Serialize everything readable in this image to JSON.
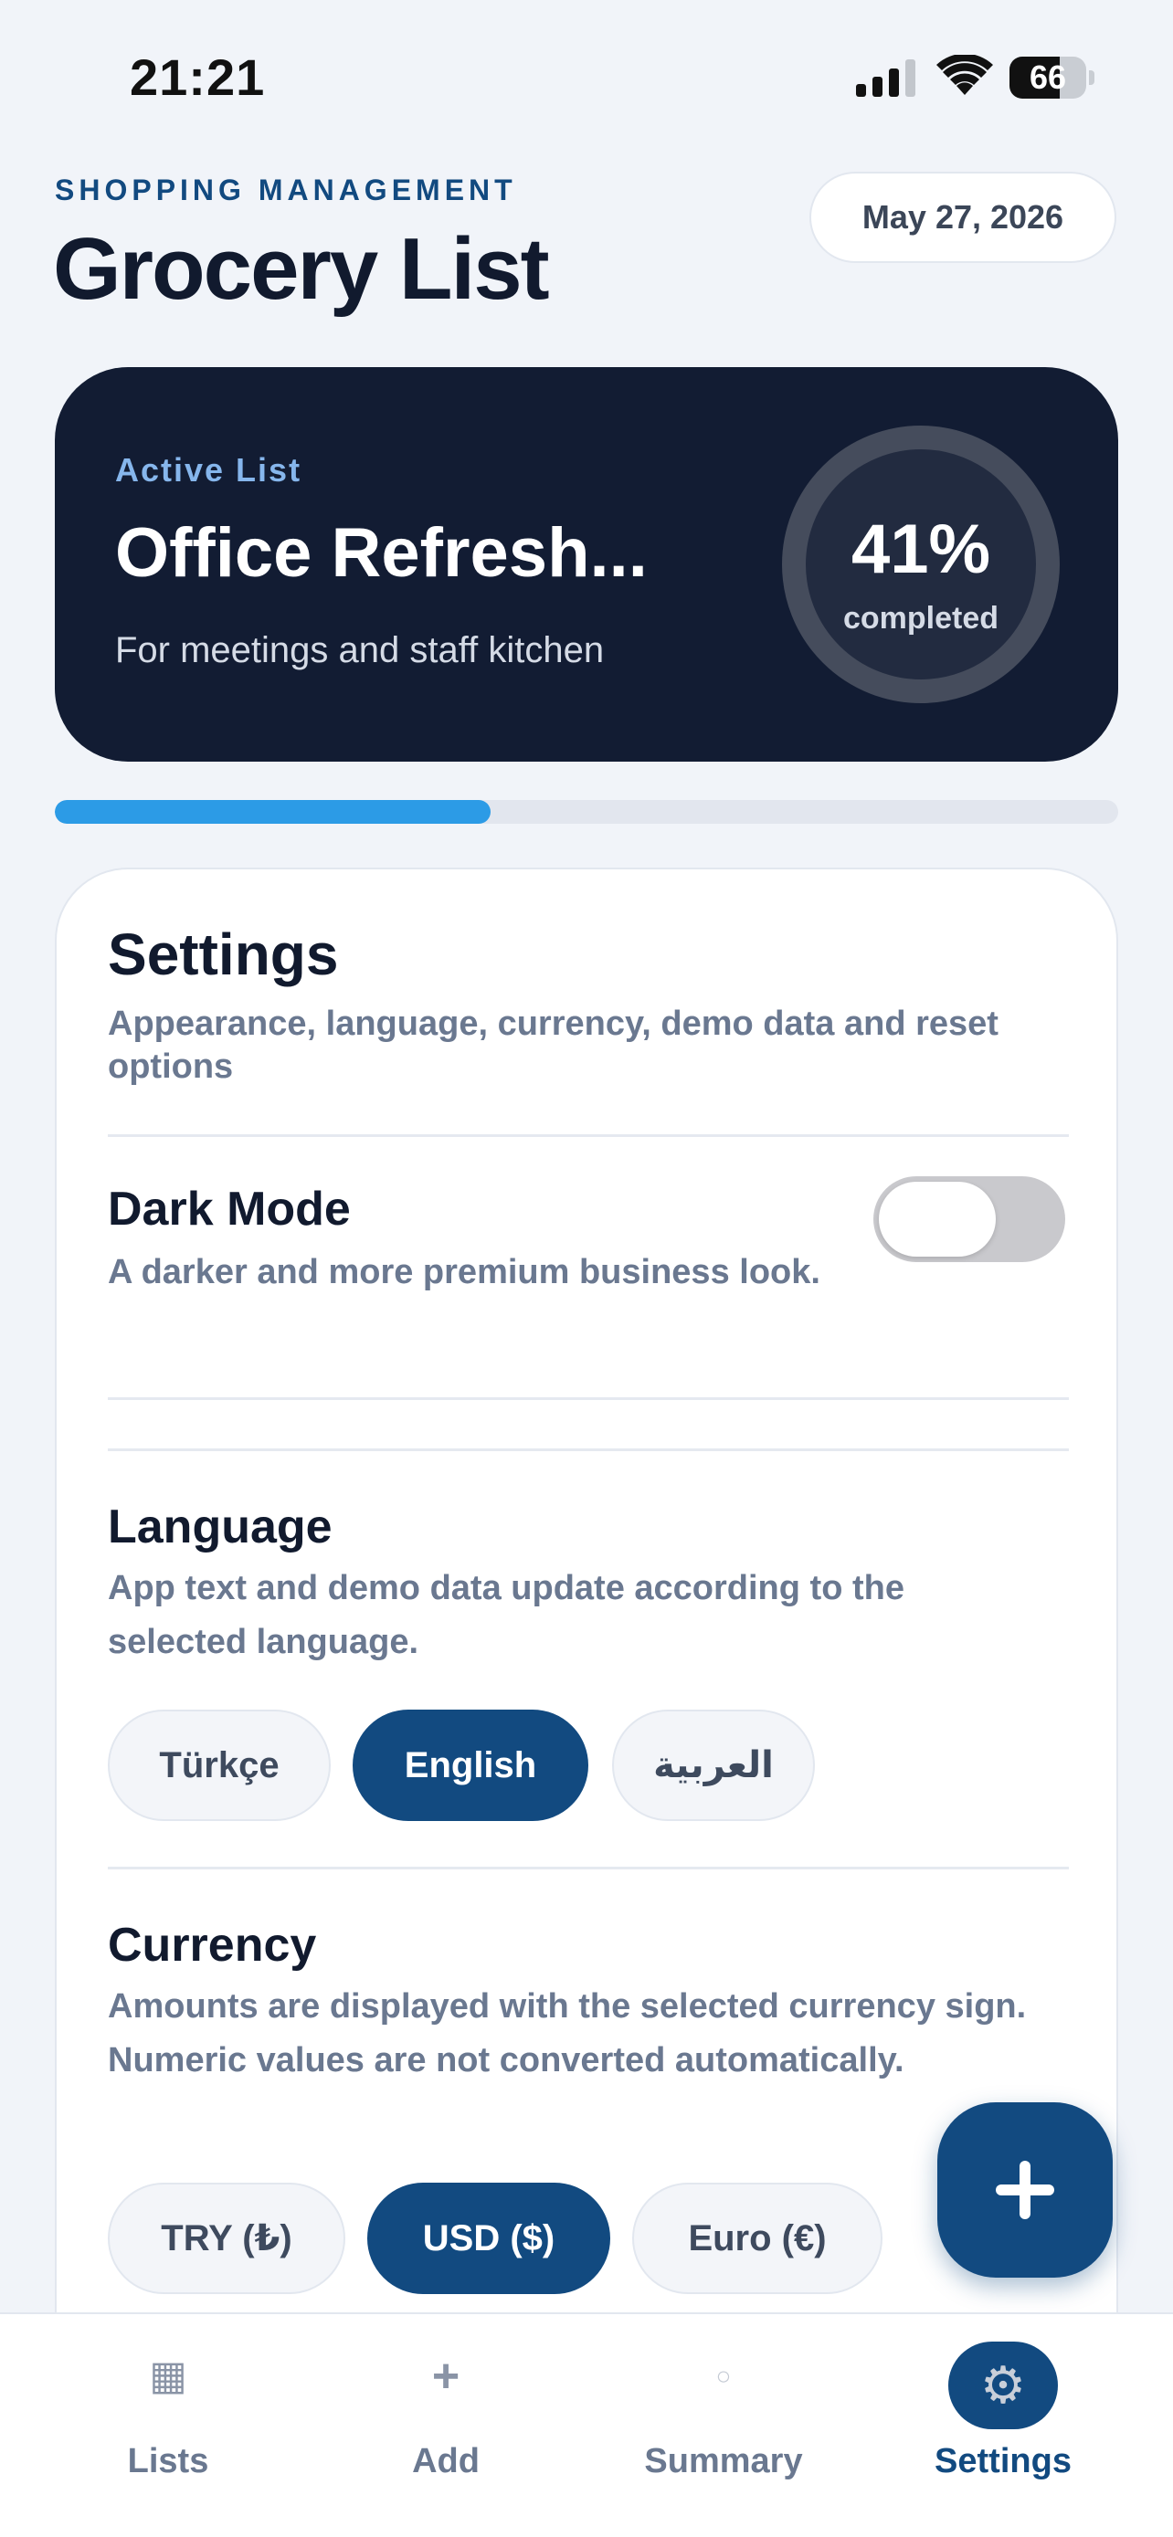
{
  "status_bar": {
    "time": "21:21",
    "battery": "66",
    "battery_level": 0.66
  },
  "header": {
    "kicker": "SHOPPING MANAGEMENT",
    "title": "Grocery List",
    "date": "May 27, 2026"
  },
  "active_list": {
    "label": "Active List",
    "name": "Office Refresh...",
    "description": "For meetings and staff kitchen",
    "percent_text": "41%",
    "caption": "completed",
    "progress": 0.41,
    "accent_color": "#2c9be6"
  },
  "settings": {
    "title": "Settings",
    "subtitle": "Appearance, language, currency, demo data and reset options",
    "dark_mode": {
      "title": "Dark Mode",
      "description": "A darker and more premium business look.",
      "enabled": false
    },
    "language": {
      "title": "Language",
      "description": "App text and demo data update according to the selected language.",
      "options": [
        "Türkçe",
        "English",
        "العربية"
      ],
      "selected": "English"
    },
    "currency": {
      "title": "Currency",
      "description": "Amounts are displayed with the selected currency sign. Numeric values are not converted automatically.",
      "options": [
        "TRY (₺)",
        "USD ($)",
        "Euro (€)"
      ],
      "selected": "USD ($)"
    }
  },
  "fab": {
    "icon": "plus-icon"
  },
  "nav": {
    "items": [
      {
        "label": "Lists",
        "icon": "grid-icon",
        "glyph": "▦"
      },
      {
        "label": "Add",
        "icon": "plus-icon",
        "glyph": "+"
      },
      {
        "label": "Summary",
        "icon": "circle-icon",
        "glyph": "○"
      },
      {
        "label": "Settings",
        "icon": "gear-icon",
        "glyph": "⚙"
      }
    ],
    "active": "Settings"
  },
  "colors": {
    "brand": "#124a80",
    "hero_bg": "#121c33",
    "background": "#f1f4f9"
  }
}
